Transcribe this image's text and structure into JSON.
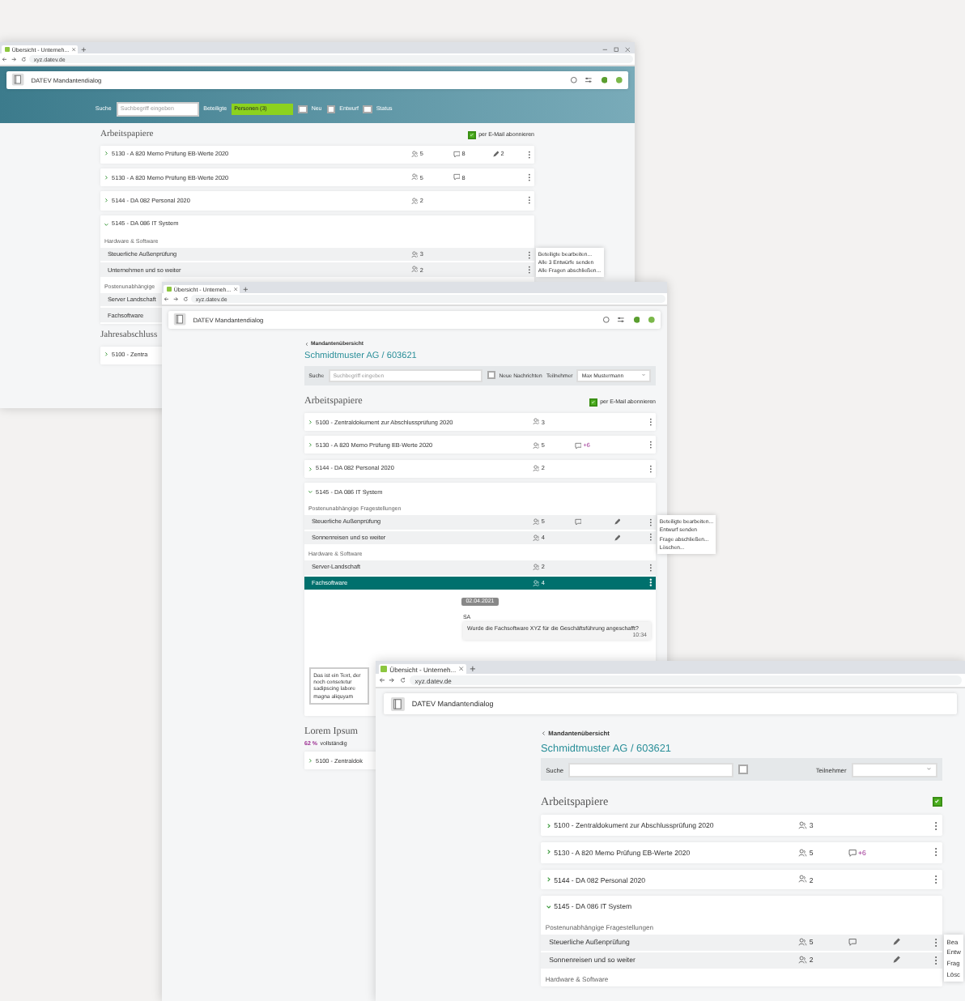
{
  "windows": [
    {
      "tab_title": "Übersicht - Unterneh...",
      "url": "xyz.datev.de",
      "window_controls": true,
      "header_icons": true,
      "app_title": "DATEV Mandantendialog",
      "filter_bar": {
        "search_label": "Suche",
        "search_placeholder": "Suchbegriff eingeben",
        "select_label": "Beteiligte",
        "select_value": "Personen (3)",
        "checkboxes": [
          {
            "label": "Neu",
            "checked": false
          },
          {
            "label": "Entwurf",
            "checked": false
          },
          {
            "label": "Status",
            "checked": false
          }
        ]
      },
      "sections": [
        {
          "title": "Arbeitspapiere",
          "subscribe": {
            "label": "per E-Mail abonnieren",
            "checked": true
          },
          "papers": [
            {
              "title": "5130 - A 820 Memo Prüfung EB-Werte 2020",
              "expanded": false,
              "stats": [
                {
                  "kind": "people",
                  "text": "5"
                },
                {
                  "kind": "comments",
                  "text": "8"
                },
                {
                  "kind": "edits",
                  "text": "2"
                }
              ]
            },
            {
              "title": "5130 - A 820 Memo Prüfung EB-Werte 2020",
              "expanded": false,
              "stats": [
                {
                  "kind": "people",
                  "text": "5"
                },
                {
                  "kind": "comments",
                  "text": "8"
                }
              ]
            },
            {
              "title": "5144 - DA 082 Personal 2020",
              "expanded": false,
              "stats": [
                {
                  "kind": "people",
                  "text": "2"
                }
              ]
            },
            {
              "title": "5145 - DA 086 IT System",
              "expanded": true,
              "groups": [
                {
                  "title": "Hardware & Software",
                  "rows": [
                    {
                      "title": "Steuerliche Außenprüfung",
                      "selected": false,
                      "stats": [
                        {
                          "kind": "people",
                          "text": "3"
                        }
                      ],
                      "menu": [
                        "Beteiligte bearbeiten...",
                        "Alle 3 Entwürfe senden",
                        "Alle Fragen abschließen..."
                      ]
                    },
                    {
                      "title": "Unternehmen und so weiter",
                      "selected": false,
                      "stats": [
                        {
                          "kind": "people",
                          "text": "2"
                        }
                      ]
                    }
                  ]
                },
                {
                  "title": "Postenunabhängige",
                  "rows": [
                    {
                      "title": "Server Landschaft",
                      "selected": false
                    },
                    {
                      "title": "Fachsoftware",
                      "selected": false
                    }
                  ]
                }
              ]
            }
          ]
        },
        {
          "title": "Jahresabschluss",
          "papers": [
            {
              "title": "5100 - Zentra",
              "expanded": false
            }
          ]
        }
      ]
    },
    {
      "tab_title": "Übersicht - Unterneh...",
      "url": "xyz.datev.de",
      "header_icons": true,
      "app_title": "DATEV Mandantendialog",
      "breadcrumb": "Mandantenübersicht",
      "client_title": "Schmidtmuster AG / 603621",
      "search_panel": {
        "label": "Suche",
        "placeholder": "Suchbegriff eingeben",
        "checkbox": {
          "label": "Neue Nachrichten",
          "checked": false
        },
        "select_label": "Teilnehmer",
        "select_value": "Max Mustermann"
      },
      "sections": [
        {
          "title": "Arbeitspapiere",
          "subscribe": {
            "label": "per E-Mail abonnieren",
            "checked": true
          },
          "papers": [
            {
              "title": "5100 - Zentraldokument zur Abschlussprüfung 2020",
              "expanded": false,
              "stats": [
                {
                  "kind": "people",
                  "text": "3"
                }
              ]
            },
            {
              "title": "5130 - A 820 Memo Prüfung EB-Werte 2020",
              "expanded": false,
              "stats": [
                {
                  "kind": "people",
                  "text": "5"
                },
                {
                  "kind": "new_comments",
                  "text": "+6"
                }
              ]
            },
            {
              "title": "5144 - DA 082 Personal 2020",
              "expanded": false,
              "stats": [
                {
                  "kind": "people",
                  "text": "2"
                }
              ]
            },
            {
              "title": "5145 - DA 086 IT System",
              "expanded": true,
              "groups": [
                {
                  "title": "Postenunabhängige Fragestellungen",
                  "rows": [
                    {
                      "title": "Steuerliche Außenprüfung",
                      "selected": false,
                      "stats": [
                        {
                          "kind": "people",
                          "text": "5"
                        },
                        {
                          "kind": "comments"
                        },
                        {
                          "kind": "edits"
                        }
                      ],
                      "menu": [
                        "Beteiligte bearbeiten...",
                        "Entwurf senden",
                        "Frage abschließen...",
                        "Löschen..."
                      ]
                    },
                    {
                      "title": "Sonnenreisen und so weiter",
                      "selected": false,
                      "stats": [
                        {
                          "kind": "people",
                          "text": "4"
                        },
                        {
                          "kind": "edits"
                        }
                      ]
                    }
                  ]
                },
                {
                  "title": "Hardware & Software",
                  "rows": [
                    {
                      "title": "Server-Landschaft",
                      "selected": false,
                      "stats": [
                        {
                          "kind": "people",
                          "text": "2"
                        }
                      ]
                    },
                    {
                      "title": "Fachsoftware",
                      "selected": true,
                      "stats": [
                        {
                          "kind": "people",
                          "text": "4"
                        }
                      ]
                    }
                  ]
                }
              ],
              "chat": {
                "date": "02.04.2021",
                "sender": "SA",
                "message": "Wurde die Fachsoftware XYZ für die Geschäftsführung angeschafft?",
                "time": "10:34",
                "draft": "Das ist ein Text, der noch consetetur sadipscing labore magna aliquyam"
              }
            }
          ]
        },
        {
          "title": "Lorem Ipsum",
          "progress": {
            "percent": "62 %",
            "label": "vollständig"
          },
          "papers": [
            {
              "title": "5100 - Zentraldok",
              "expanded": false
            }
          ]
        }
      ]
    },
    {
      "tab_title": "Übersicht - Unterneh...",
      "url": "xyz.datev.de",
      "app_title": "DATEV Mandantendialog",
      "breadcrumb": "Mandantenübersicht",
      "client_title": "Schmidtmuster AG / 603621",
      "search_panel": {
        "label": "Suche",
        "checkbox": {
          "checked": false
        },
        "select_label": "Teilnehmer"
      },
      "sections": [
        {
          "title": "Arbeitspapiere",
          "subscribe": {
            "checked": true
          },
          "papers": [
            {
              "title": "5100 - Zentraldokument zur Abschlussprüfung 2020",
              "expanded": false,
              "stats": [
                {
                  "kind": "people",
                  "text": "3"
                }
              ]
            },
            {
              "title": "5130 - A 820 Memo Prüfung EB-Werte 2020",
              "expanded": false,
              "stats": [
                {
                  "kind": "people",
                  "text": "5"
                },
                {
                  "kind": "new_comments",
                  "text": "+6"
                }
              ]
            },
            {
              "title": "5144 - DA 082 Personal 2020",
              "expanded": false,
              "stats": [
                {
                  "kind": "people",
                  "text": "2"
                }
              ]
            },
            {
              "title": "5145 - DA 086 IT System",
              "expanded": true,
              "groups": [
                {
                  "title": "Postenunabhängige Fragestellungen",
                  "rows": [
                    {
                      "title": "Steuerliche Außenprüfung",
                      "selected": false,
                      "stats": [
                        {
                          "kind": "people",
                          "text": "5"
                        },
                        {
                          "kind": "comments"
                        },
                        {
                          "kind": "edits"
                        }
                      ],
                      "menu": [
                        "Bea",
                        "Entw",
                        "Frag",
                        "Lösc"
                      ]
                    },
                    {
                      "title": "Sonnenreisen und so weiter",
                      "selected": false,
                      "stats": [
                        {
                          "kind": "people",
                          "text": "2"
                        },
                        {
                          "kind": "edits"
                        }
                      ]
                    }
                  ]
                },
                {
                  "title": "Hardware & Software"
                }
              ]
            }
          ]
        }
      ]
    }
  ]
}
